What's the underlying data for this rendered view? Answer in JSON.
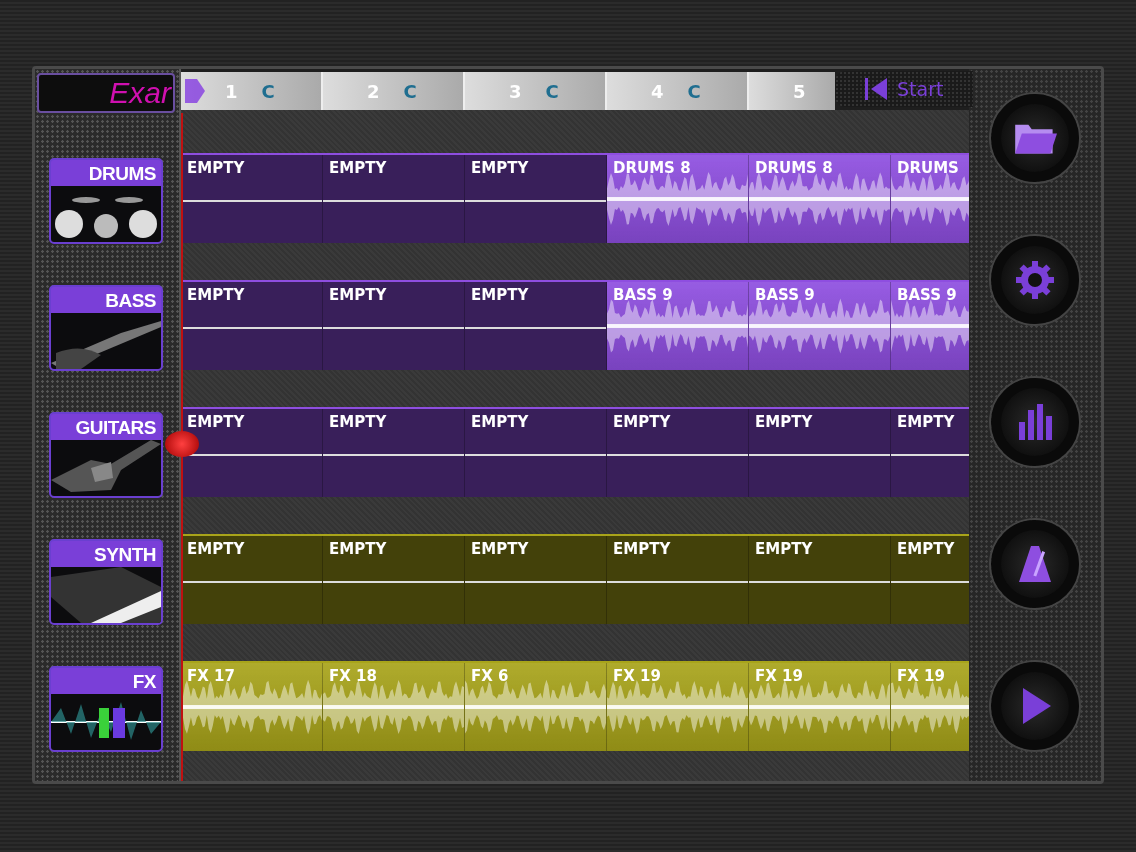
{
  "project": {
    "title": "Exar"
  },
  "bars": [
    {
      "number": "1",
      "key": "C"
    },
    {
      "number": "2",
      "key": "C"
    },
    {
      "number": "3",
      "key": "C"
    },
    {
      "number": "4",
      "key": "C"
    },
    {
      "number": "5"
    }
  ],
  "transport": {
    "start": "Start"
  },
  "tracks": [
    {
      "name": "DRUMS",
      "color": "#8e4ee0",
      "clips": [
        {
          "label": "EMPTY",
          "kind": "empty"
        },
        {
          "label": "EMPTY",
          "kind": "empty"
        },
        {
          "label": "EMPTY",
          "kind": "empty"
        },
        {
          "label": "DRUMS 8",
          "kind": "audio"
        },
        {
          "label": "DRUMS 8",
          "kind": "audio"
        },
        {
          "label": "DRUMS",
          "kind": "audio"
        }
      ]
    },
    {
      "name": "BASS",
      "color": "#8e4ee0",
      "clips": [
        {
          "label": "EMPTY",
          "kind": "empty"
        },
        {
          "label": "EMPTY",
          "kind": "empty"
        },
        {
          "label": "EMPTY",
          "kind": "empty"
        },
        {
          "label": "BASS 9",
          "kind": "audio"
        },
        {
          "label": "BASS 9",
          "kind": "audio"
        },
        {
          "label": "BASS 9",
          "kind": "audio"
        }
      ]
    },
    {
      "name": "GUITARS",
      "color": "#8e4ee0",
      "clips": [
        {
          "label": "EMPTY",
          "kind": "empty"
        },
        {
          "label": "EMPTY",
          "kind": "empty"
        },
        {
          "label": "EMPTY",
          "kind": "empty"
        },
        {
          "label": "EMPTY",
          "kind": "empty"
        },
        {
          "label": "EMPTY",
          "kind": "empty"
        },
        {
          "label": "EMPTY",
          "kind": "empty"
        }
      ]
    },
    {
      "name": "SYNTH",
      "color": "#a8a41a",
      "clips": [
        {
          "label": "EMPTY",
          "kind": "empty"
        },
        {
          "label": "EMPTY",
          "kind": "empty"
        },
        {
          "label": "EMPTY",
          "kind": "empty"
        },
        {
          "label": "EMPTY",
          "kind": "empty"
        },
        {
          "label": "EMPTY",
          "kind": "empty"
        },
        {
          "label": "EMPTY",
          "kind": "empty"
        }
      ]
    },
    {
      "name": "FX",
      "color": "#a8a41a",
      "clips": [
        {
          "label": "FX 17",
          "kind": "audio"
        },
        {
          "label": "FX 18",
          "kind": "audio"
        },
        {
          "label": "FX 6",
          "kind": "audio"
        },
        {
          "label": "FX 19",
          "kind": "audio"
        },
        {
          "label": "FX 19",
          "kind": "audio"
        },
        {
          "label": "FX 19",
          "kind": "audio"
        }
      ]
    }
  ]
}
